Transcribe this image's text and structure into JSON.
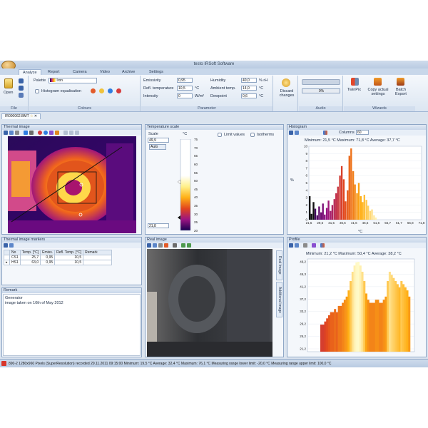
{
  "window_title": "testo IRSoft Software",
  "tabs": [
    "Analyze",
    "Report",
    "Camera",
    "Video",
    "Archive",
    "Settings"
  ],
  "ribbon": {
    "file": {
      "open_label": "Open",
      "group_label": "File"
    },
    "colours": {
      "palette_label": "Palette",
      "palette_value": "Iron",
      "histogram_eq_label": "Histogram equalisation",
      "group_label": "Colours"
    },
    "parameter": {
      "emissivity_label": "Emissivity",
      "emissivity_value": "0,95",
      "refl_temp_label": "Refl. temperature",
      "refl_temp_value": "10,5",
      "refl_temp_unit": "°C",
      "intensity_label": "Intensity",
      "intensity_value": "0",
      "intensity_unit": "W/m²",
      "humidity_label": "Humidity",
      "humidity_value": "40,0",
      "humidity_unit": "% rH",
      "ambient_label": "Ambient temp.",
      "ambient_value": "14,0",
      "ambient_unit": "°C",
      "dewpoint_label": "Dewpoint",
      "dewpoint_value": "0,6",
      "dewpoint_unit": "°C",
      "group_label": "Parameter"
    },
    "discard_label": "Discard changes",
    "audio": {
      "time_value": "0%",
      "group_label": "Audio"
    },
    "wizards": {
      "twinpix_label": "TwinPix",
      "copy_label": "Copy actual settings",
      "batch_label": "Batch Export",
      "group_label": "Wizards"
    }
  },
  "document_tab": "IR000062.BMT",
  "thermal_image": {
    "title": "Thermal image"
  },
  "temperature_scale": {
    "title": "Temperature scale",
    "scale_label": "Scale",
    "unit_label": "°C",
    "max_value": "49,9",
    "min_value": "21,8",
    "auto_label": "Auto",
    "limit_values_label": "Limit values",
    "isotherms_label": "Isotherms",
    "ticks": [
      "75",
      "70",
      "65",
      "60",
      "55",
      "50",
      "45",
      "40",
      "35",
      "30",
      "25",
      "20"
    ]
  },
  "histogram": {
    "title": "Histogram",
    "columns_label": "Columns",
    "columns_value": "60",
    "stats": "Minimum: 21,5 °C Maximum: 71,8 °C Average: 37,7 °C",
    "ylabel": "%",
    "xlabel": "°C",
    "y_ticks": [
      "10",
      "9",
      "8",
      "7",
      "6",
      "5",
      "4",
      "3",
      "2",
      "1",
      "0"
    ],
    "x_ticks": [
      "21,5",
      "29,5",
      "31,5",
      "36,6",
      "41,6",
      "46,6",
      "51,6",
      "56,7",
      "61,7",
      "66,8",
      "71,8"
    ]
  },
  "markers": {
    "title": "Thermal image markers",
    "headers": [
      "No",
      "Temp. [°C]",
      "Emiss.",
      "Refl. Temp. [°C]",
      "Remark"
    ],
    "rows": [
      [
        "CS1",
        "25,7",
        "0,95",
        "10,5",
        ""
      ],
      [
        "HS1",
        "63,0",
        "0,95",
        "10,5",
        ""
      ]
    ]
  },
  "remark": {
    "title": "Remark",
    "line1": "Generator",
    "line2": "image taken on 10th of May 2012"
  },
  "real_image": {
    "title": "Real image",
    "side_tab1": "Real Image",
    "side_tab2": "Additional image"
  },
  "profile": {
    "title": "Profile",
    "stats": "Minimum: 21,2 °C Maximum: 50,4 °C Average: 38,2 °C",
    "y_ticks": [
      "49,2",
      "45,3",
      "41,2",
      "37,2",
      "33,2",
      "29,2",
      "25,2",
      "21,2"
    ]
  },
  "status_bar": "890-2 1280x960 Pixels (SuperResolution) recorded 29.11.2011 09:15:00  Minimum: 19,5 °C  Average: 32,4 °C  Maximum: 76,1 °C  Measuring range lower limit: -20,0 °C  Measuring range upper limit: 100,0 °C",
  "chart_data": [
    {
      "type": "bar",
      "title": "Histogram",
      "xlabel": "°C",
      "ylabel": "%",
      "ylim": [
        0,
        10
      ],
      "xlim": [
        21.5,
        71.8
      ],
      "x": [
        21.5,
        22.3,
        23.2,
        24.0,
        24.9,
        25.7,
        26.6,
        27.4,
        28.2,
        29.1,
        29.9,
        30.8,
        31.6,
        32.5,
        33.3,
        34.1,
        35.0,
        35.8,
        36.7,
        37.5,
        38.4,
        39.2,
        40.0,
        40.9,
        41.7,
        42.6,
        43.4,
        44.3,
        45.1,
        45.9,
        46.8,
        47.6,
        48.5,
        49.3,
        50.2,
        51.0
      ],
      "values": [
        3.2,
        0.8,
        2.4,
        1.5,
        0.6,
        1.8,
        1.0,
        2.2,
        0.7,
        1.6,
        2.6,
        1.2,
        2.0,
        2.8,
        3.6,
        4.5,
        6.0,
        7.3,
        5.5,
        2.5,
        4.0,
        8.7,
        9.7,
        6.6,
        4.8,
        3.6,
        5.0,
        3.2,
        2.4,
        3.4,
        2.7,
        1.9,
        1.2,
        1.4,
        0.6,
        0.3
      ]
    },
    {
      "type": "area",
      "title": "Profile",
      "ylim": [
        21.2,
        49.2
      ],
      "values": [
        29,
        29,
        30,
        31,
        32,
        33,
        33,
        34,
        33,
        35,
        35,
        36,
        37,
        38,
        40,
        43,
        46,
        48,
        49,
        49.2,
        48,
        46,
        43,
        39,
        37,
        36,
        36,
        36,
        37,
        37,
        36,
        36,
        37,
        38,
        43,
        46,
        45,
        44,
        43,
        42,
        41,
        43,
        42,
        41,
        40,
        38
      ]
    }
  ]
}
